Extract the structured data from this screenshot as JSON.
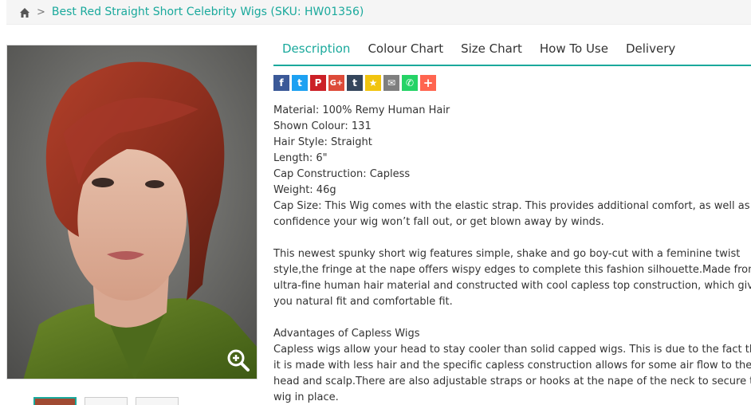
{
  "breadcrumb": {
    "home_icon": "home-icon",
    "separator": ">",
    "current": "Best Red Straight Short Celebrity Wigs (SKU: HW01356)"
  },
  "colors": {
    "accent": "#1aa99c",
    "facebook": "#3b5998",
    "twitter": "#1da1f2",
    "pinterest": "#cb2027",
    "googleplus": "#dd4b39",
    "tumblr": "#35465c",
    "favorite": "#f1c40f",
    "email": "#7f7f7f",
    "whatsapp": "#25d366",
    "more": "#ff6550"
  },
  "tabs": [
    {
      "label": "Description",
      "active": true
    },
    {
      "label": "Colour Chart",
      "active": false
    },
    {
      "label": "Size Chart",
      "active": false
    },
    {
      "label": "How To Use",
      "active": false
    },
    {
      "label": "Delivery",
      "active": false
    }
  ],
  "share": {
    "buttons": [
      {
        "name": "facebook",
        "glyph": "f"
      },
      {
        "name": "twitter",
        "glyph": "t"
      },
      {
        "name": "pinterest",
        "glyph": "P"
      },
      {
        "name": "googleplus",
        "glyph": "G+"
      },
      {
        "name": "tumblr",
        "glyph": "t"
      },
      {
        "name": "favorite",
        "glyph": "★"
      },
      {
        "name": "email",
        "glyph": "✉"
      },
      {
        "name": "whatsapp",
        "glyph": "✆"
      },
      {
        "name": "more",
        "glyph": "+"
      }
    ]
  },
  "description": {
    "specs": [
      "Material: 100% Remy Human Hair",
      "Shown Colour: 131",
      "Hair Style: Straight",
      "Length: 6\"",
      "Cap Construction: Capless",
      "Weight: 46g",
      "Cap Size: This Wig comes with the elastic strap. This provides additional comfort, as well as",
      "confidence your wig won’t fall out, or get blown away by winds."
    ],
    "para1": [
      "This newest spunky short wig features simple, shake and go boy-cut with a feminine twist",
      "style,the fringe at the nape offers wispy edges to complete this fashion silhouette.Made from",
      "ultra-fine human hair material and constructed with cool capless top construction, which give",
      "you natural fit and comfortable fit."
    ],
    "para2": [
      "Advantages of Capless Wigs",
      "Capless wigs allow your head to stay cooler than solid capped wigs. This is due to the fact that",
      "it is made with less hair and the specific capless construction allows for some air flow to the",
      "head and scalp.There are also adjustable straps or hooks at the nape of the neck to secure the",
      "wig in place."
    ]
  },
  "product_image": {
    "zoom_icon": "zoom-in-icon"
  },
  "thumbnails": [
    {
      "active": true
    },
    {
      "active": false
    },
    {
      "active": false
    }
  ]
}
